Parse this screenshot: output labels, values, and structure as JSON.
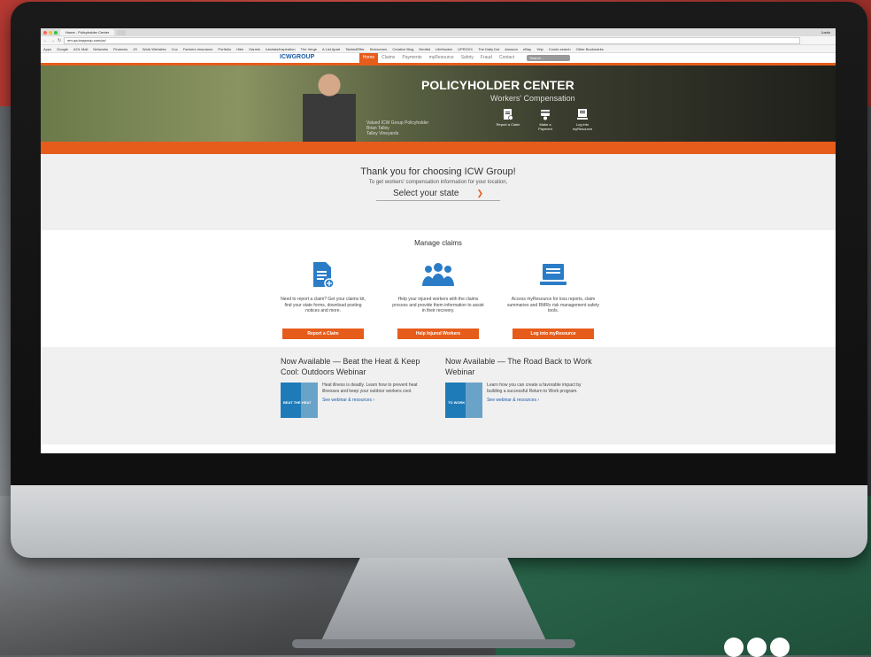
{
  "browser": {
    "tab_title": "Home - Policyholder Center",
    "profile": "Justin",
    "url": "em-qa.icwgroup.com/pc/",
    "bookmarks": [
      "Apps",
      "Google",
      "AOL Mail",
      "Networks",
      "Finances",
      "JS",
      "Work Websites",
      "Cox",
      "Farmers Insurance",
      "Portfolio",
      "Hike",
      "Garmin",
      "tutorials/inspiration",
      "The Verge",
      "A List Apart",
      "TabbedEffer",
      "Kickscreen",
      "Creative Blog",
      "Nerdist",
      "LifeHacker",
      "UPROXX",
      "The Daily Dot",
      "Amazon",
      "eBay",
      "Yelp",
      "Condo search",
      "Other Bookmarks"
    ]
  },
  "site": {
    "logo": "ICWGROUP",
    "nav": [
      "Home",
      "Claims",
      "Payments",
      "myResource",
      "Safety",
      "Fraud",
      "Contact"
    ],
    "search_placeholder": "Search ...",
    "hero": {
      "title": "POLICYHOLDER CENTER",
      "subtitle": "Workers' Compensation",
      "caption_1": "Valued ICW Group Policyholder",
      "caption_2": "Brian Talley",
      "caption_3": "Talley Vineyards",
      "actions": [
        {
          "label": "Report a Claim",
          "icon": "claim-icon"
        },
        {
          "label": "Make a Payment",
          "icon": "payment-icon"
        },
        {
          "label": "Log into myResource",
          "icon": "laptop-icon"
        }
      ]
    },
    "thanks": {
      "title": "Thank you for choosing ICW Group!",
      "subtitle": "To get workers' compensation information for your location,",
      "state_label": "Select your state"
    },
    "manage": {
      "title": "Manage claims",
      "cards": [
        {
          "text": "Need to report a claim? Get your claims kit, find your state forms, download posting notices and more.",
          "button": "Report a Claim",
          "icon": "document-icon"
        },
        {
          "text": "Help your injured workers with the claims process and provide them information to assist in their recovery.",
          "button": "Help Injured Workers",
          "icon": "workers-icon"
        },
        {
          "text": "Access myResource for loss reports, claim summaries and RMRx risk management safety tools.",
          "button": "Log into myResource",
          "icon": "laptop-icon"
        }
      ]
    },
    "webinars": [
      {
        "title": "Now Available — Beat the Heat & Keep Cool: Outdoors Webinar",
        "thumb": "BEAT THE HEAT",
        "text": "Heat illness is deadly. Learn how to prevent heat illnesses and keep your outdoor workers cool.",
        "link": "See webinar & resources ›"
      },
      {
        "title": "Now Available — The Road Back to Work Webinar",
        "thumb": "TO WORK",
        "text": "Learn how you can create a favorable impact by building a successful Return to Work program.",
        "link": "See webinar & resources ›"
      }
    ]
  },
  "colors": {
    "accent": "#e65c1b",
    "link": "#1a5aa8"
  }
}
